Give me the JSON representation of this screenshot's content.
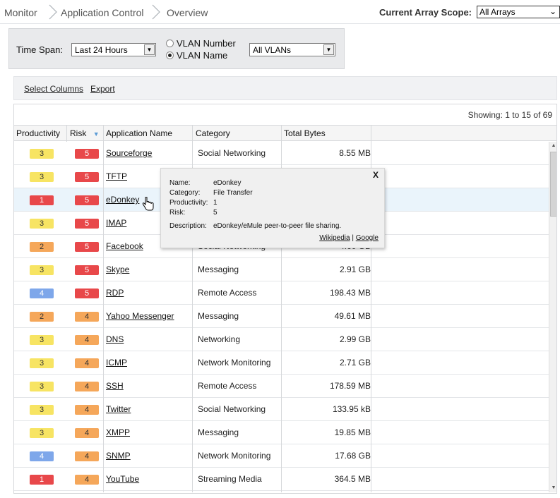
{
  "breadcrumb": {
    "items": [
      "Monitor",
      "Application Control",
      "Overview"
    ]
  },
  "array_scope": {
    "label": "Current Array Scope:",
    "value": "All Arrays"
  },
  "filters": {
    "time_span_label": "Time Span:",
    "time_span_value": "Last 24 Hours",
    "vlan_number_label": "VLAN Number",
    "vlan_name_label": "VLAN Name",
    "vlan_selected": "VLAN Name",
    "vlan_value": "All VLANs"
  },
  "toolbar": {
    "select_columns": "Select Columns",
    "export": "Export"
  },
  "grid": {
    "showing": "Showing: 1 to 15 of 69",
    "columns": {
      "productivity": "Productivity",
      "risk": "Risk",
      "app_name": "Application Name",
      "category": "Category",
      "total_bytes": "Total Bytes"
    },
    "rows": [
      {
        "productivity": "3",
        "risk": "5",
        "app": "Sourceforge",
        "category": "Social Networking",
        "bytes": "8.55 MB"
      },
      {
        "productivity": "3",
        "risk": "5",
        "app": "TFTP",
        "category": "",
        "bytes": ""
      },
      {
        "productivity": "1",
        "risk": "5",
        "app": "eDonkey",
        "category": "",
        "bytes": ""
      },
      {
        "productivity": "3",
        "risk": "5",
        "app": "IMAP",
        "category": "",
        "bytes": ""
      },
      {
        "productivity": "2",
        "risk": "5",
        "app": "Facebook",
        "category": "Social Networking",
        "bytes": "4.60 GB"
      },
      {
        "productivity": "3",
        "risk": "5",
        "app": "Skype",
        "category": "Messaging",
        "bytes": "2.91 GB"
      },
      {
        "productivity": "4",
        "risk": "5",
        "app": "RDP",
        "category": "Remote Access",
        "bytes": "198.43 MB"
      },
      {
        "productivity": "2",
        "risk": "4",
        "app": "Yahoo Messenger",
        "category": "Messaging",
        "bytes": "49.61 MB"
      },
      {
        "productivity": "3",
        "risk": "4",
        "app": "DNS",
        "category": "Networking",
        "bytes": "2.99 GB"
      },
      {
        "productivity": "3",
        "risk": "4",
        "app": "ICMP",
        "category": "Network Monitoring",
        "bytes": "2.71 GB"
      },
      {
        "productivity": "3",
        "risk": "4",
        "app": "SSH",
        "category": "Remote Access",
        "bytes": "178.59 MB"
      },
      {
        "productivity": "3",
        "risk": "4",
        "app": "Twitter",
        "category": "Social Networking",
        "bytes": "133.95 kB"
      },
      {
        "productivity": "3",
        "risk": "4",
        "app": "XMPP",
        "category": "Messaging",
        "bytes": "19.85 MB"
      },
      {
        "productivity": "4",
        "risk": "4",
        "app": "SNMP",
        "category": "Network Monitoring",
        "bytes": "17.68 GB"
      },
      {
        "productivity": "1",
        "risk": "4",
        "app": "YouTube",
        "category": "Streaming Media",
        "bytes": "364.5 MB"
      }
    ]
  },
  "popup": {
    "close": "X",
    "name_label": "Name:",
    "name_value": "eDonkey",
    "category_label": "Category:",
    "category_value": "File Transfer",
    "productivity_label": "Productivity:",
    "productivity_value": "1",
    "risk_label": "Risk:",
    "risk_value": "5",
    "description_label": "Description:",
    "description_value": "eDonkey/eMule peer-to-peer file sharing.",
    "link_wikipedia": "Wikipedia",
    "link_separator": "|",
    "link_google": "Google"
  },
  "colors": {
    "productivity_1": "#e8484a",
    "productivity_2": "#f5a75a",
    "productivity_3": "#f7e463",
    "productivity_4": "#7ea7ea",
    "risk_5": "#e8484a",
    "risk_4": "#f5a75a"
  }
}
